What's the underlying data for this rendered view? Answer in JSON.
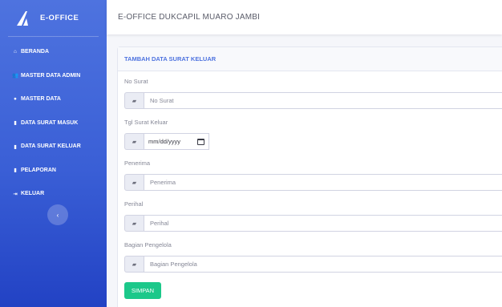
{
  "brand": {
    "name": "E-OFFICE",
    "logo_icon": "arrow-logo-icon"
  },
  "header": {
    "title": "E-OFFICE DUKCAPIL MUARO JAMBI"
  },
  "sidebar": {
    "items": [
      {
        "label": "BERANDA",
        "icon": "home-icon",
        "glyph": "⌂"
      },
      {
        "label": "MASTER DATA ADMIN",
        "icon": "users-icon",
        "glyph": "👥"
      },
      {
        "label": "MASTER DATA",
        "icon": "circle-icon",
        "glyph": "●"
      },
      {
        "label": "DATA SURAT MASUK",
        "icon": "file-icon",
        "glyph": "▮"
      },
      {
        "label": "DATA SURAT KELUAR",
        "icon": "file-icon",
        "glyph": "▮"
      },
      {
        "label": "PELAPORAN",
        "icon": "file-icon",
        "glyph": "▮"
      },
      {
        "label": "KELUAR",
        "icon": "sign-out-icon",
        "glyph": "⇥"
      }
    ],
    "toggle_glyph": "‹"
  },
  "form": {
    "title": "TAMBAH DATA SURAT KELUAR",
    "fields": {
      "no_surat": {
        "label": "No Surat",
        "placeholder": "No Surat"
      },
      "tgl": {
        "label": "Tgl Surat Keluar",
        "value": "mm/dd/yyyy"
      },
      "penerima": {
        "label": "Penerima",
        "placeholder": "Penerima"
      },
      "perihal": {
        "label": "Perihal",
        "placeholder": "Perihal"
      },
      "bagian": {
        "label": "Bagian Pengelola",
        "placeholder": "Bagian Pengelola"
      }
    },
    "addon_glyph": "▰",
    "submit_label": "SIMPAN"
  },
  "colors": {
    "sidebar": "#4e73df",
    "accent": "#4e73df",
    "success": "#1cc88a"
  }
}
